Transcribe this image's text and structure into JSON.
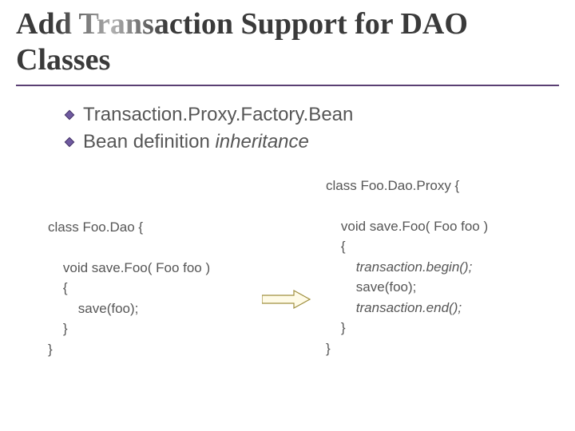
{
  "title": "Add Transaction Support for DAO Classes",
  "bullets": {
    "b1": "Transaction.Proxy.Factory.Bean",
    "b2_plain": "Bean definition ",
    "b2_italic": "inheritance"
  },
  "code_left": {
    "l1": "class Foo.Dao {",
    "l2": "    void save.Foo( Foo foo )",
    "l3": "    {",
    "l4": "        save(foo);",
    "l5": "    }",
    "l6": "}"
  },
  "code_right": {
    "l1": "class Foo.Dao.Proxy {",
    "l2": "    void save.Foo( Foo foo )",
    "l3": "    {",
    "l4a": "        ",
    "l4b": "transaction.begin();",
    "l5": "        save(foo);",
    "l6a": "        ",
    "l6b": "transaction.end();",
    "l7": "    }",
    "l8": "}"
  }
}
